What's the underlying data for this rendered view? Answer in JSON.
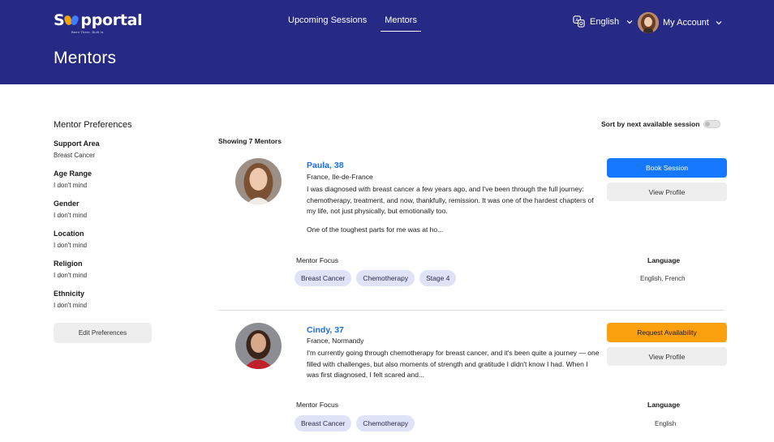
{
  "brand": {
    "name_prefix": "S",
    "name_suffix": "pportal",
    "tagline": "Been There. Built In."
  },
  "nav": {
    "items": [
      {
        "label": "Upcoming Sessions",
        "active": false
      },
      {
        "label": "Mentors",
        "active": true
      }
    ]
  },
  "language_selector": {
    "label": "English",
    "icon": "translate-icon"
  },
  "account": {
    "label": "My Account"
  },
  "page": {
    "title": "Mentors"
  },
  "sidebar": {
    "title": "Mentor Preferences",
    "groups": [
      {
        "label": "Support Area",
        "value": "Breast Cancer"
      },
      {
        "label": "Age Range",
        "value": "I don't mind"
      },
      {
        "label": "Gender",
        "value": "I don't mind"
      },
      {
        "label": "Location",
        "value": "I don't mind"
      },
      {
        "label": "Religion",
        "value": "I don't mind"
      },
      {
        "label": "Ethnicity",
        "value": "I don't mind"
      }
    ],
    "edit_button": "Edit Preferences"
  },
  "list": {
    "showing": "Showing 7 Mentors",
    "sort_label": "Sort by next available session",
    "sort_enabled": false
  },
  "mentors": [
    {
      "name": "Paula, 38",
      "location": "France, Ile-de-France",
      "bio": "I was diagnosed with breast cancer a few years ago, and I've been through the full journey: chemotherapy, treatment, and now, thankfully, remission. It was one of the hardest chapters of my life, not just physically, but emotionally too.",
      "bio_more": "One of the toughest parts for me was at ho...",
      "primary_action": "Book Session",
      "secondary_action": "View Profile",
      "focus_label": "Mentor Focus",
      "focus": [
        "Breast Cancer",
        "Chemotherapy",
        "Stage 4"
      ],
      "language_label": "Language",
      "languages": "English,  French"
    },
    {
      "name": "Cindy, 37",
      "location": "France, Normandy",
      "bio": "I'm currently going through chemotherapy for breast cancer, and it's been quite a journey — one filled with challenges, but also moments of strength and gratitude I didn't know I had. When I was first diagnosed, I felt scared and...",
      "primary_action": "Request Availability",
      "secondary_action": "View Profile",
      "focus_label": "Mentor Focus",
      "focus": [
        "Breast Cancer",
        "Chemotherapy"
      ],
      "language_label": "Language",
      "languages": "English"
    }
  ],
  "colors": {
    "header": "#262a85",
    "link": "#1a6cf0",
    "primary": "#1677ff",
    "warning": "#fba10f",
    "tag": "#dfe3f7"
  }
}
